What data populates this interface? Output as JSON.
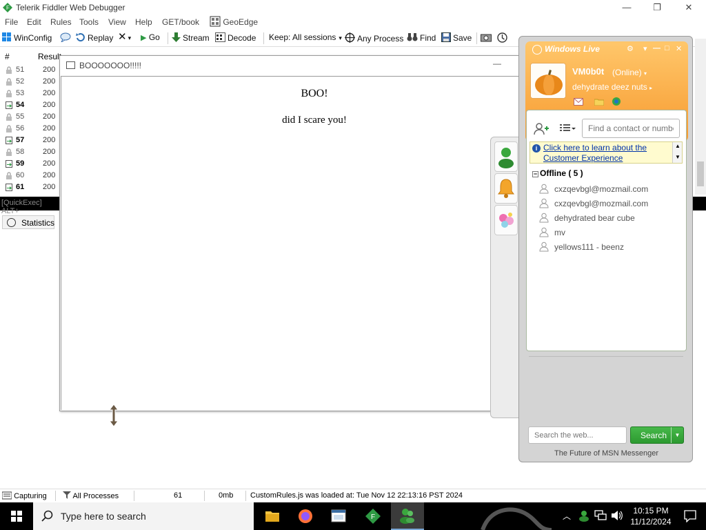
{
  "fiddler": {
    "title": "Telerik Fiddler Web Debugger",
    "menu": [
      "File",
      "Edit",
      "Rules",
      "Tools",
      "View",
      "Help",
      "GET/book",
      "GeoEdge"
    ],
    "toolbar": {
      "winconfig": "WinConfig",
      "replay": "Replay",
      "go": "Go",
      "stream": "Stream",
      "decode": "Decode",
      "keep": "Keep: All sessions",
      "any_process": "Any Process",
      "find": "Find",
      "save": "Save"
    },
    "sessions": {
      "col_num": "#",
      "col_result": "Result",
      "rows": [
        {
          "num": "51",
          "result": "200",
          "hot": false
        },
        {
          "num": "52",
          "result": "200",
          "hot": false
        },
        {
          "num": "53",
          "result": "200",
          "hot": false
        },
        {
          "num": "54",
          "result": "200",
          "hot": true
        },
        {
          "num": "55",
          "result": "200",
          "hot": false
        },
        {
          "num": "56",
          "result": "200",
          "hot": false
        },
        {
          "num": "57",
          "result": "200",
          "hot": true
        },
        {
          "num": "58",
          "result": "200",
          "hot": false
        },
        {
          "num": "59",
          "result": "200",
          "hot": true
        },
        {
          "num": "60",
          "result": "200",
          "hot": false
        },
        {
          "num": "61",
          "result": "200",
          "hot": true
        }
      ]
    },
    "quickexec": "[QuickExec] ALT+",
    "statistics_tab": "Statistics",
    "status": {
      "capturing": "Capturing",
      "processes": "All Processes",
      "count": "61",
      "size": "0mb",
      "message": "CustomRules.js was loaded at: Tue Nov 12 22:13:16 PST 2024"
    }
  },
  "dialog": {
    "title": "BOOOOOOO!!!!!",
    "heading": "BOO!",
    "text": "did I scare you!"
  },
  "messenger": {
    "brand": "Windows Live",
    "name": "VM0b0t",
    "status": "(Online)",
    "personal_message": "dehydrate deez nuts",
    "find_placeholder": "Find a contact or number",
    "banner_link": "Click here to learn about the Customer Experience",
    "group": "Offline ( 5 )",
    "contacts": [
      "cxzqevbgl@mozmail.com",
      "cxzqevbgl@mozmail.com",
      "dehydrated bear cube",
      "mv",
      "yellows111 - beenz"
    ],
    "search_placeholder": "Search the web...",
    "search_label": "Search",
    "tagline": "The Future of MSN Messenger"
  },
  "taskbar": {
    "search_label": "Type here to search",
    "time": "10:15 PM",
    "date": "11/12/2024"
  },
  "colors": {
    "msn_orange": "#f79a2f",
    "search_green": "#2c9a30",
    "link_blue": "#0033aa"
  }
}
